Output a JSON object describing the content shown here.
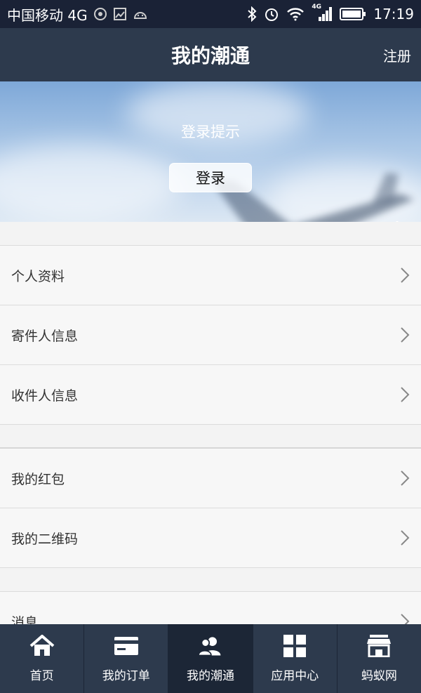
{
  "status_bar": {
    "carrier": "中国移动 4G",
    "network_small": "4G",
    "time": "17:19"
  },
  "header": {
    "title": "我的潮通",
    "register_label": "注册"
  },
  "hero": {
    "hint": "登录提示",
    "login_label": "登录"
  },
  "menu": {
    "group1": [
      "个人资料",
      "寄件人信息",
      "收件人信息"
    ],
    "group2": [
      "我的红包",
      "我的二维码"
    ],
    "group3": [
      "消息"
    ]
  },
  "tabs": [
    {
      "label": "首页",
      "icon": "home-icon"
    },
    {
      "label": "我的订单",
      "icon": "card-icon"
    },
    {
      "label": "我的潮通",
      "icon": "users-icon",
      "active": true
    },
    {
      "label": "应用中心",
      "icon": "grid-icon"
    },
    {
      "label": "蚂蚁网",
      "icon": "store-icon"
    }
  ],
  "colors": {
    "status_bar": "#1a2236",
    "header": "#2d3a4d",
    "tab_active": "#1c2636"
  }
}
